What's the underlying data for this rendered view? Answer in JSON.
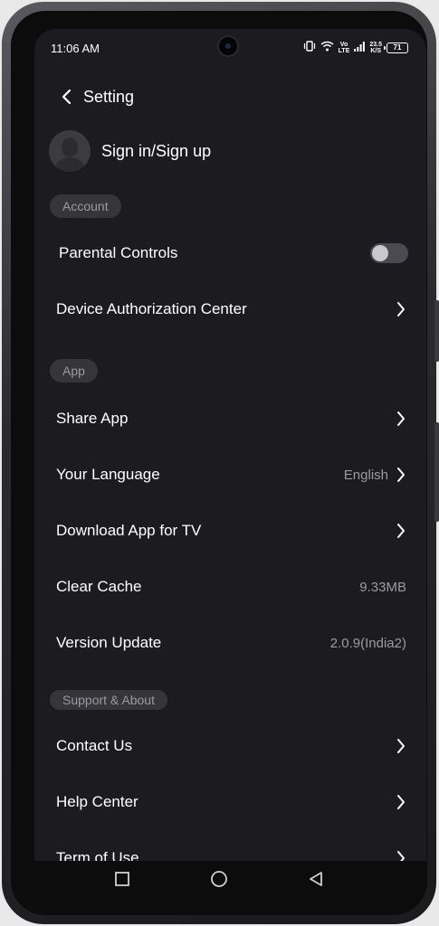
{
  "status_bar": {
    "time": "11:06 AM",
    "network_label_top": "Vo",
    "network_label_bottom": "LTE",
    "speed_top": "23.5",
    "speed_bottom": "K/S",
    "battery": "71"
  },
  "header": {
    "title": "Setting"
  },
  "profile": {
    "label": "Sign in/Sign up"
  },
  "sections": {
    "account": "Account",
    "app": "App",
    "support": "Support & About"
  },
  "rows": {
    "parental_controls": {
      "label": "Parental Controls",
      "enabled": false
    },
    "device_authorization": {
      "label": "Device Authorization Center"
    },
    "share_app": {
      "label": "Share App"
    },
    "language": {
      "label": "Your Language",
      "value": "English"
    },
    "download_tv": {
      "label": "Download App for TV"
    },
    "clear_cache": {
      "label": "Clear Cache",
      "value": "9.33MB"
    },
    "version_update": {
      "label": "Version Update",
      "value": "2.0.9(India2)"
    },
    "contact_us": {
      "label": "Contact Us"
    },
    "help_center": {
      "label": "Help Center"
    },
    "term_of_use": {
      "label": "Term of Use"
    }
  },
  "icons": {
    "back": "chevron-left-icon",
    "row_arrow": "chevron-right-icon",
    "nav_recent": "square-icon",
    "nav_home": "circle-icon",
    "nav_back": "triangle-back-icon"
  },
  "colors": {
    "background": "#1c1c20",
    "chip_bg": "#35353a",
    "secondary_text": "#9a9aa0",
    "toggle_off": "#4a4a52"
  }
}
